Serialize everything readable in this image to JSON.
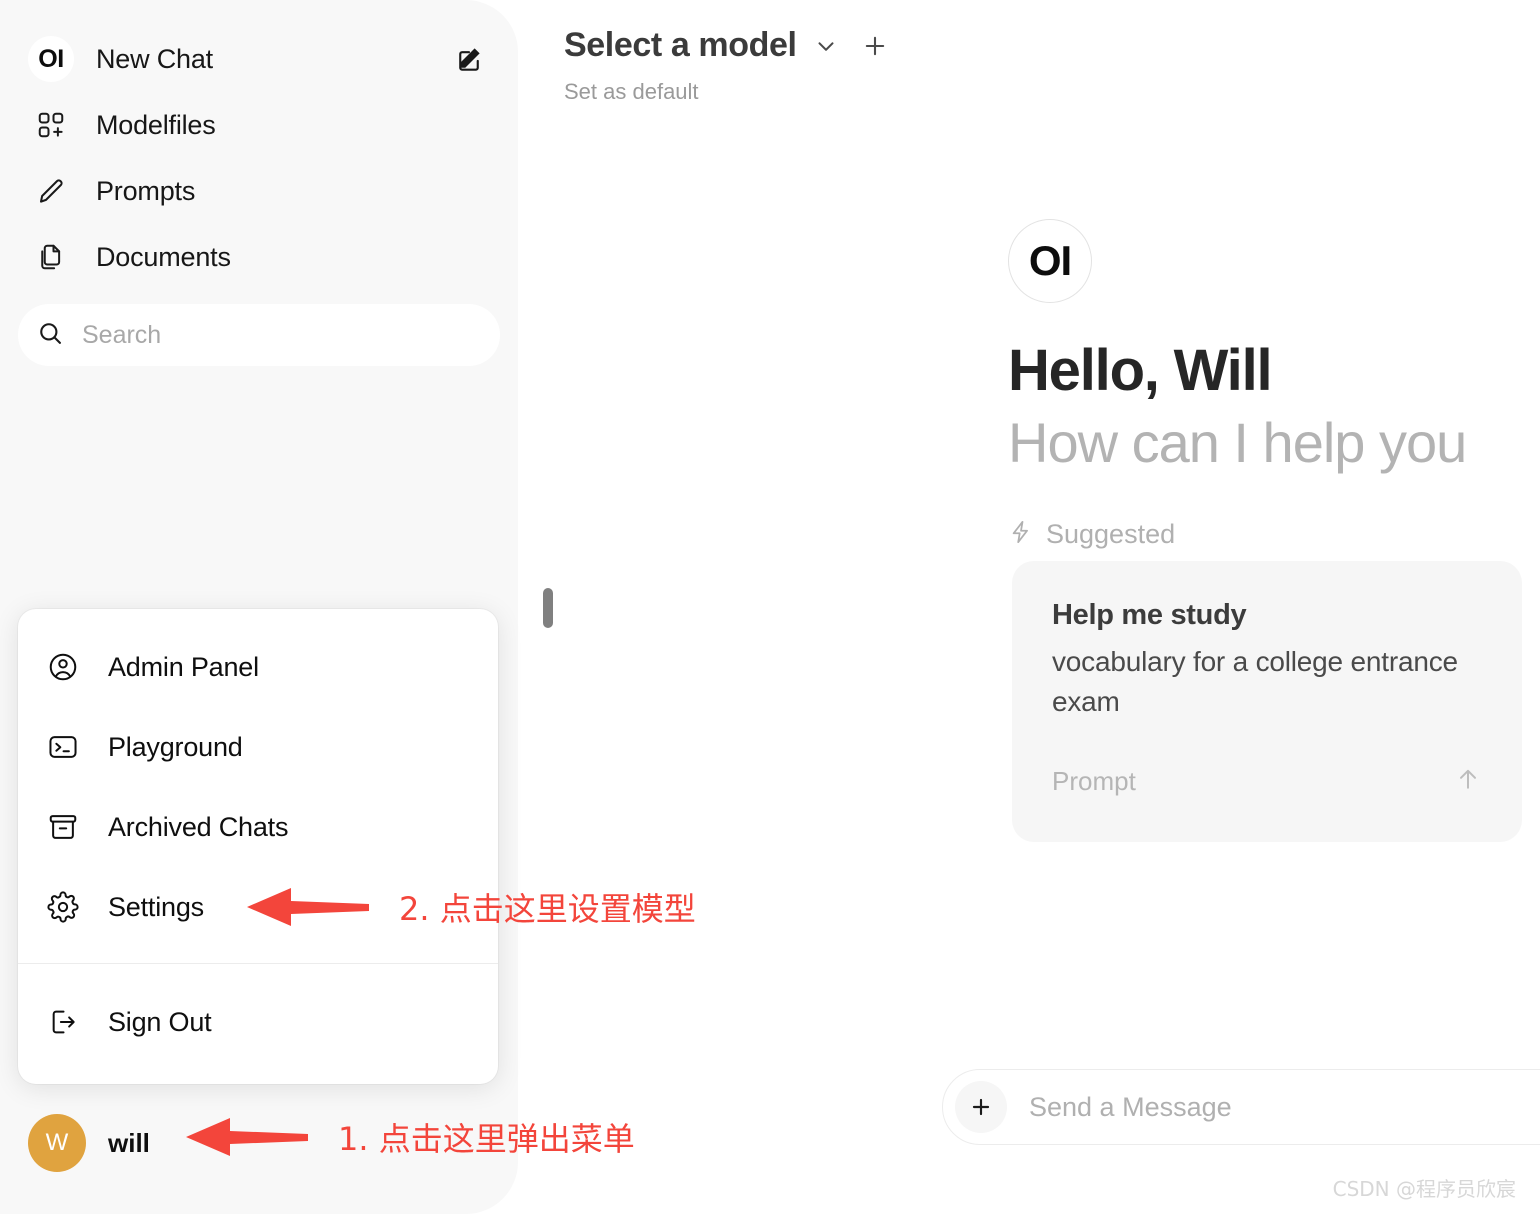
{
  "colors": {
    "sidebar_bg": "#f8f8f8",
    "accent_red": "#f3453b",
    "avatar_bg": "#e0a33f",
    "card_bg": "#f6f6f6",
    "text_primary": "#171717",
    "text_muted": "#b0b0b0"
  },
  "sidebar": {
    "logo_text": "OI",
    "new_chat_label": "New Chat",
    "edit_icon": "edit-square-pencil-icon",
    "nav_items": [
      {
        "label": "Modelfiles",
        "icon": "modelfiles-grid-plus-icon"
      },
      {
        "label": "Prompts",
        "icon": "pencil-icon"
      },
      {
        "label": "Documents",
        "icon": "documents-copy-icon"
      }
    ],
    "search": {
      "placeholder": "Search",
      "icon": "search-icon",
      "value": ""
    },
    "user": {
      "initial": "W",
      "name": "will"
    }
  },
  "popup_menu": {
    "items": [
      {
        "label": "Admin Panel",
        "icon": "user-circle-icon"
      },
      {
        "label": "Playground",
        "icon": "terminal-icon"
      },
      {
        "label": "Archived Chats",
        "icon": "archive-box-icon"
      },
      {
        "label": "Settings",
        "icon": "gear-icon"
      }
    ],
    "footer_items": [
      {
        "label": "Sign Out",
        "icon": "sign-out-icon"
      }
    ]
  },
  "main": {
    "model_selector": {
      "title": "Select a model",
      "chevron_icon": "chevron-down-icon",
      "add_icon": "plus-icon",
      "set_default_label": "Set as default"
    },
    "greeting": {
      "logo_text": "OI",
      "hello": "Hello, Will",
      "subtitle": "How can I help you",
      "suggested_label": "Suggested",
      "suggested_icon": "lightning-bolt-icon"
    },
    "suggestion_card": {
      "title": "Help me study",
      "description": "vocabulary for a college entrance exam",
      "footer_label": "Prompt",
      "footer_icon": "arrow-up-icon"
    },
    "composer": {
      "placeholder": "Send a Message",
      "add_icon": "plus-icon"
    }
  },
  "annotations": {
    "step1": "1. 点击这里弹出菜单",
    "step2": "2. 点击这里设置模型"
  },
  "watermark": "CSDN @程序员欣宸"
}
